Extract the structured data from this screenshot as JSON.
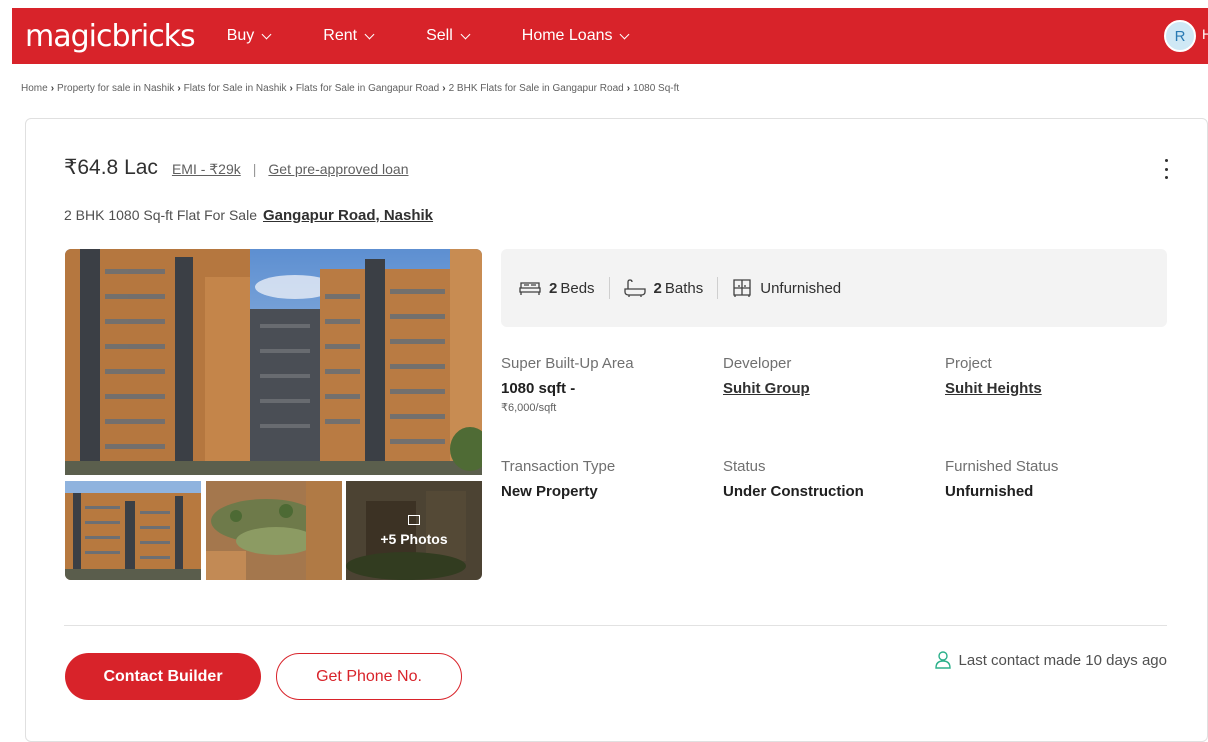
{
  "header": {
    "logo": "magicbricks",
    "nav": [
      {
        "label": "Buy"
      },
      {
        "label": "Rent"
      },
      {
        "label": "Sell"
      },
      {
        "label": "Home Loans"
      }
    ],
    "avatar_initial": "R",
    "avatar_tail": "H",
    "brand_color": "#d8232a"
  },
  "breadcrumb": [
    "Home",
    "Property for sale in Nashik",
    "Flats for Sale in Nashik",
    "Flats for Sale in Gangapur Road",
    "2 BHK Flats for Sale in Gangapur Road",
    "1080 Sq-ft"
  ],
  "listing": {
    "price": "₹64.8 Lac",
    "emi": "EMI - ₹29k",
    "separator": "|",
    "loan_link": "Get pre-approved loan",
    "title": "2 BHK 1080 Sq-ft Flat For Sale",
    "location": "Gangapur Road, Nashik",
    "photos_more": "+5 Photos",
    "summary": {
      "beds_num": "2",
      "beds_label": "Beds",
      "baths_num": "2",
      "baths_label": "Baths",
      "furnishing": "Unfurnished"
    },
    "details": {
      "area_label": "Super Built-Up Area",
      "area_value": "1080 sqft -",
      "area_rate": "₹6,000/sqft",
      "developer_label": "Developer",
      "developer_value": "Suhit Group",
      "project_label": "Project",
      "project_value": "Suhit Heights",
      "transaction_label": "Transaction Type",
      "transaction_value": "New Property",
      "status_label": "Status",
      "status_value": "Under Construction",
      "furnished_label": "Furnished Status",
      "furnished_value": "Unfurnished"
    },
    "contact_button": "Contact Builder",
    "phone_button": "Get Phone No.",
    "last_contact": "Last contact made 10 days ago"
  }
}
